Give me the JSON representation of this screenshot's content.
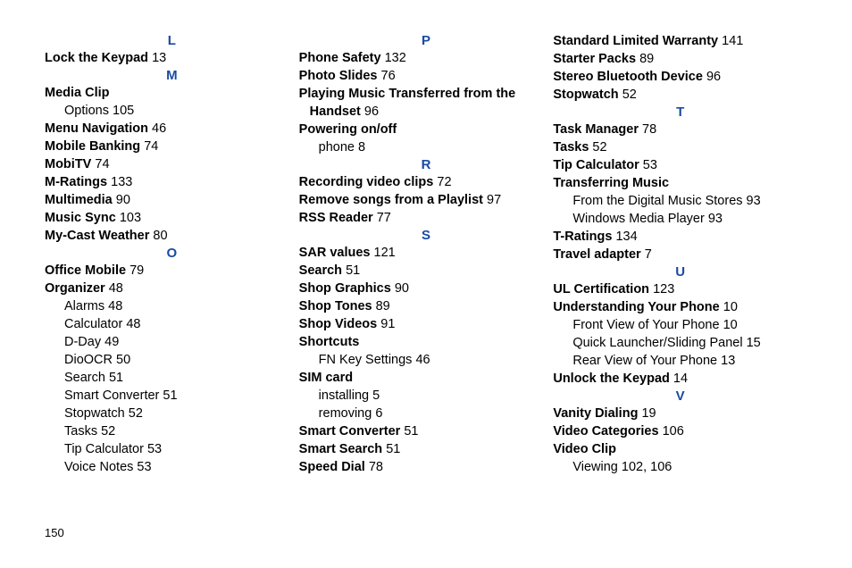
{
  "pageNumber": "150",
  "col1": {
    "headL": "L",
    "lockKeypad": {
      "t": "Lock the Keypad",
      "p": "13"
    },
    "headM": "M",
    "mediaClip": {
      "t": "Media Clip"
    },
    "mediaClipOptions": {
      "t": "Options",
      "p": "105"
    },
    "menuNav": {
      "t": "Menu Navigation",
      "p": "46"
    },
    "mobileBanking": {
      "t": "Mobile Banking",
      "p": "74"
    },
    "mobiTV": {
      "t": "MobiTV",
      "p": "74"
    },
    "mRatings": {
      "t": "M-Ratings",
      "p": "133"
    },
    "multimedia": {
      "t": "Multimedia",
      "p": "90"
    },
    "musicSync": {
      "t": "Music Sync",
      "p": "103"
    },
    "myCast": {
      "t": "My-Cast Weather",
      "p": "80"
    },
    "headO": "O",
    "officeMobile": {
      "t": "Office Mobile",
      "p": "79"
    },
    "organizer": {
      "t": "Organizer",
      "p": "48"
    },
    "orgAlarms": {
      "t": "Alarms",
      "p": "48"
    },
    "orgCalc": {
      "t": "Calculator",
      "p": "48"
    },
    "orgDDay": {
      "t": "D-Day",
      "p": "49"
    },
    "orgDioOCR": {
      "t": "DioOCR",
      "p": "50"
    },
    "orgSearch": {
      "t": "Search",
      "p": "51"
    },
    "orgSmartConv": {
      "t": "Smart Converter",
      "p": "51"
    },
    "orgStopwatch": {
      "t": "Stopwatch",
      "p": "52"
    },
    "orgTasks": {
      "t": "Tasks",
      "p": "52"
    },
    "orgTipCalc": {
      "t": "Tip Calculator",
      "p": "53"
    },
    "orgVoiceNotes": {
      "t": "Voice Notes",
      "p": "53"
    }
  },
  "col2": {
    "headP": "P",
    "phoneSafety": {
      "t": "Phone Safety",
      "p": "132"
    },
    "photoSlides": {
      "t": "Photo Slides",
      "p": "76"
    },
    "playingMusic1": "Playing Music Transferred from the",
    "playingMusic2": {
      "t": "Handset",
      "p": "96"
    },
    "powering": {
      "t": "Powering on/off"
    },
    "poweringPhone": {
      "t": "phone",
      "p": "8"
    },
    "headR": "R",
    "recVideo": {
      "t": "Recording video clips",
      "p": "72"
    },
    "removeSongs": {
      "t": "Remove songs from a Playlist",
      "p": "97"
    },
    "rssReader": {
      "t": "RSS Reader",
      "p": "77"
    },
    "headS": "S",
    "sarValues": {
      "t": "SAR values",
      "p": "121"
    },
    "search": {
      "t": "Search",
      "p": "51"
    },
    "shopGraphics": {
      "t": "Shop Graphics",
      "p": "90"
    },
    "shopTones": {
      "t": "Shop Tones",
      "p": "89"
    },
    "shopVideos": {
      "t": "Shop Videos",
      "p": "91"
    },
    "shortcuts": {
      "t": "Shortcuts"
    },
    "shortcutsFN": {
      "t": "FN Key Settings",
      "p": "46"
    },
    "simCard": {
      "t": "SIM card"
    },
    "simInstall": {
      "t": "installing",
      "p": "5"
    },
    "simRemove": {
      "t": "removing",
      "p": "6"
    },
    "smartConv": {
      "t": "Smart Converter",
      "p": "51"
    },
    "smartSearch": {
      "t": "Smart Search",
      "p": "51"
    },
    "speedDial": {
      "t": "Speed Dial",
      "p": "78"
    }
  },
  "col3": {
    "warranty": {
      "t": "Standard Limited Warranty",
      "p": "141"
    },
    "starterPacks": {
      "t": "Starter Packs",
      "p": "89"
    },
    "stereoBt": {
      "t": "Stereo Bluetooth Device",
      "p": "96"
    },
    "stopwatch": {
      "t": "Stopwatch",
      "p": "52"
    },
    "headT": "T",
    "taskMgr": {
      "t": "Task Manager",
      "p": "78"
    },
    "tasks": {
      "t": "Tasks",
      "p": "52"
    },
    "tipCalc": {
      "t": "Tip Calculator",
      "p": "53"
    },
    "transferMusic": {
      "t": "Transferring Music"
    },
    "tmDigital": {
      "t": "From the Digital Music Stores",
      "p": "93"
    },
    "tmWMP": {
      "t": "Windows Media Player",
      "p": "93"
    },
    "tRatings": {
      "t": "T-Ratings",
      "p": "134"
    },
    "travelAdapter": {
      "t": "Travel adapter",
      "p": "7"
    },
    "headU": "U",
    "ulCert": {
      "t": "UL Certification",
      "p": "123"
    },
    "undPhone": {
      "t": "Understanding Your Phone",
      "p": "10"
    },
    "upFront": {
      "t": "Front View of Your Phone",
      "p": "10"
    },
    "upQuick": {
      "t": "Quick Launcher/Sliding Panel",
      "p": "15"
    },
    "upRear": {
      "t": "Rear View of Your Phone",
      "p": "13"
    },
    "unlockKeypad": {
      "t": "Unlock the Keypad",
      "p": "14"
    },
    "headV": "V",
    "vanityDial": {
      "t": "Vanity Dialing",
      "p": "19"
    },
    "videoCat": {
      "t": "Video Categories",
      "p": "106"
    },
    "videoClip": {
      "t": "Video Clip"
    },
    "vcViewing": {
      "t": "Viewing",
      "p": "102, 106"
    }
  }
}
